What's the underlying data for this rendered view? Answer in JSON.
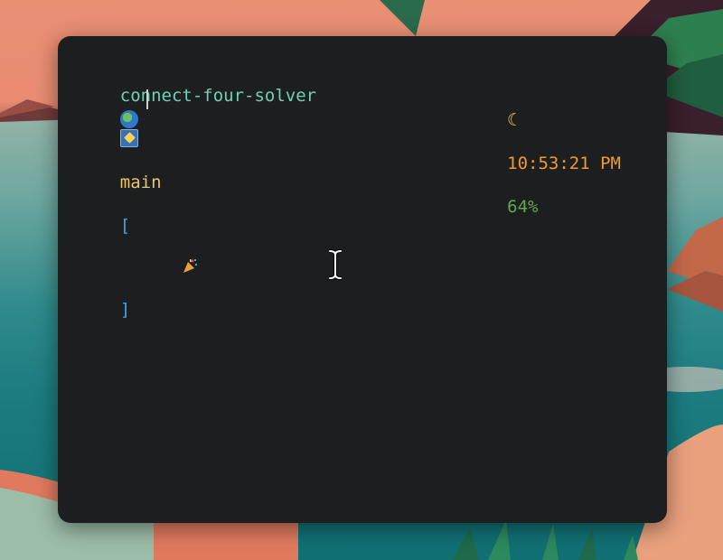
{
  "prompt": {
    "directory": "connect-four-solver",
    "git_icon": "git-branch-star-icon",
    "branch": "main",
    "status_open": "[",
    "status_icon": "party-popper-icon",
    "status_close": "]",
    "location_icon": "globe-icon"
  },
  "status": {
    "moon": "☾",
    "time": "10:53:21 PM",
    "battery": "64%"
  },
  "colors": {
    "terminal_bg": "#1c1e20",
    "directory": "#6fd0b8",
    "branch": "#e9c46a",
    "bracket": "#41a6e6",
    "time": "#f29a2e",
    "battery": "#62a84c"
  }
}
